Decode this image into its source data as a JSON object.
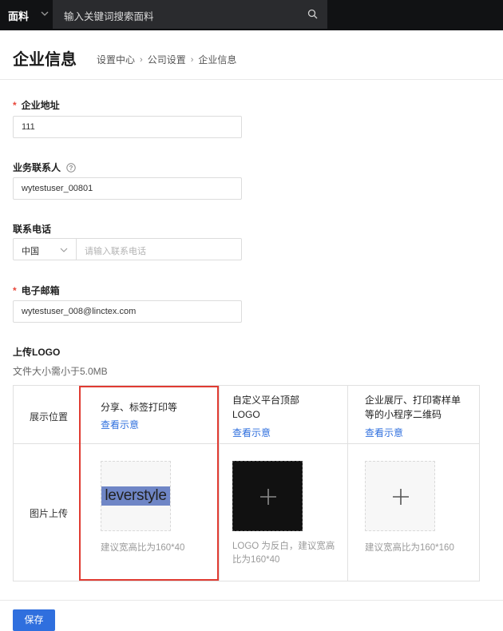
{
  "topbar": {
    "brand": "面料",
    "search_text": "输入关键词搜索面料"
  },
  "header": {
    "title": "企业信息",
    "breadcrumb": [
      "设置中心",
      "公司设置",
      "企业信息"
    ]
  },
  "form": {
    "address": {
      "label": "企业地址",
      "required": true,
      "value": "111"
    },
    "contact": {
      "label": "业务联系人",
      "value": "wytestuser_00801"
    },
    "phone": {
      "label": "联系电话",
      "country": "中国",
      "placeholder": "请输入联系电话"
    },
    "email": {
      "label": "电子邮箱",
      "required": true,
      "value": "wytestuser_008@linctex.com"
    },
    "logo": {
      "label": "上传LOGO",
      "sub": "文件大小需小于5.0MB",
      "row_position": "展示位置",
      "row_upload": "图片上传",
      "columns": [
        {
          "title": "分享、标签打印等",
          "link": "查看示意",
          "logo_text": "leverstyle",
          "tip": "建议宽高比为160*40"
        },
        {
          "title": "自定义平台顶部LOGO",
          "link": "查看示意",
          "tip": "LOGO 为反白，建议宽高比为160*40"
        },
        {
          "title": "企业展厅、打印寄样单等的小程序二维码",
          "link": "查看示意",
          "tip": "建议宽高比为160*160"
        }
      ]
    }
  },
  "actions": {
    "save_label": "保存"
  },
  "colors": {
    "accent": "#2f6fde",
    "required": "#e8463a",
    "highlight": "#e03b32",
    "topbar": "#111214"
  }
}
